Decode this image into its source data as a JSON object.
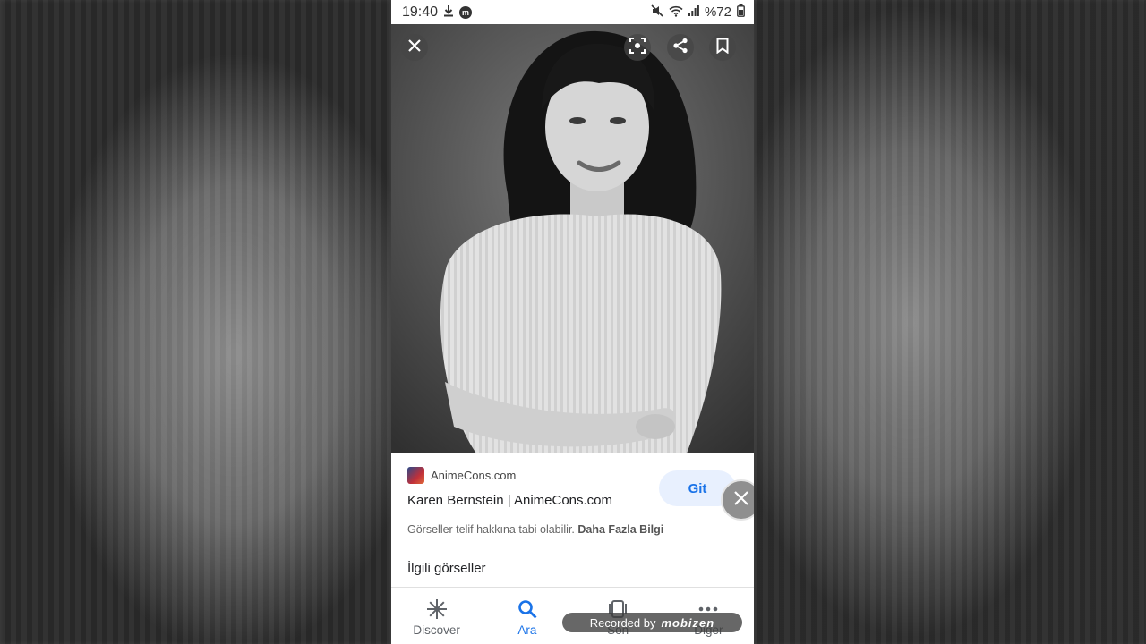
{
  "status_bar": {
    "time": "19:40",
    "battery": "%72"
  },
  "image_viewer": {
    "icons": [
      "close-icon",
      "lens-icon",
      "share-icon",
      "bookmark-icon"
    ]
  },
  "result": {
    "source": "AnimeCons.com",
    "title": "Karen Bernstein | AnimeCons.com",
    "go_label": "Git",
    "copyright_text": "Görseller telif hakkına tabi olabilir.",
    "more_info_link": "Daha Fazla Bilgi"
  },
  "related_heading": "İlgili görseller",
  "bottom_nav": {
    "items": [
      {
        "label": "Discover",
        "icon": "asterisk-icon",
        "active": false
      },
      {
        "label": "Ara",
        "icon": "search-icon",
        "active": true
      },
      {
        "label": "Son",
        "icon": "recent-tabs-icon",
        "active": false
      },
      {
        "label": "Diğer",
        "icon": "more-icon",
        "active": false
      }
    ]
  },
  "watermark": {
    "prefix": "Recorded by",
    "brand": "mobizen"
  },
  "colors": {
    "accent": "#1a73e8",
    "accent_bg": "#e8f0fe"
  }
}
